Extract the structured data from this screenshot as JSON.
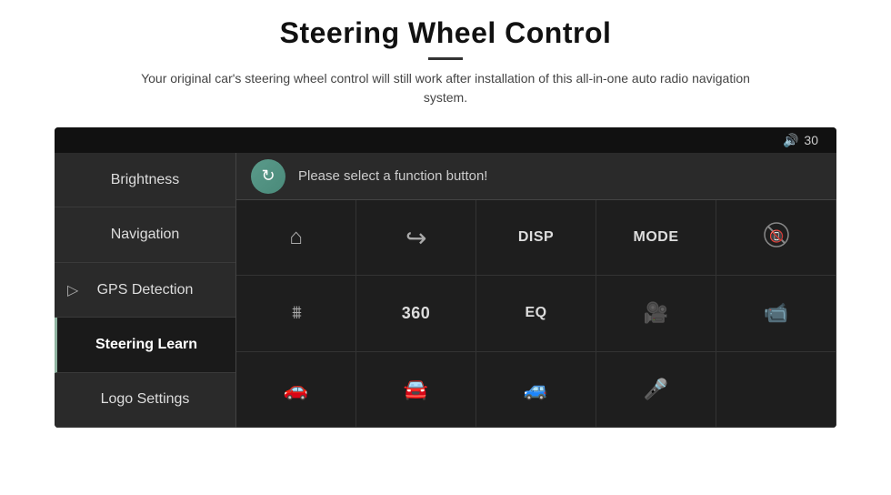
{
  "header": {
    "title": "Steering Wheel Control",
    "divider": true,
    "subtitle": "Your original car's steering wheel control will still work after installation of this all-in-one auto radio navigation system."
  },
  "status_bar": {
    "volume_icon": "🔊",
    "volume_value": "30"
  },
  "sidebar": {
    "items": [
      {
        "id": "brightness",
        "label": "Brightness",
        "active": false
      },
      {
        "id": "navigation",
        "label": "Navigation",
        "active": false
      },
      {
        "id": "gps-detection",
        "label": "GPS Detection",
        "active": false
      },
      {
        "id": "steering-learn",
        "label": "Steering Learn",
        "active": true
      },
      {
        "id": "logo-settings",
        "label": "Logo Settings",
        "active": false
      }
    ]
  },
  "prompt": {
    "text": "Please select a function button!"
  },
  "grid": {
    "rows": [
      [
        {
          "id": "home",
          "icon": "⌂",
          "type": "icon"
        },
        {
          "id": "back",
          "icon": "↺",
          "type": "icon"
        },
        {
          "id": "disp",
          "label": "DISP",
          "type": "text"
        },
        {
          "id": "mode",
          "label": "MODE",
          "type": "text"
        },
        {
          "id": "phone-off",
          "icon": "⊘",
          "type": "icon"
        }
      ],
      [
        {
          "id": "tuner",
          "icon": "♯",
          "type": "icon"
        },
        {
          "id": "360",
          "label": "360",
          "type": "text"
        },
        {
          "id": "eq",
          "label": "EQ",
          "type": "text"
        },
        {
          "id": "camera1",
          "icon": "📷",
          "type": "icon"
        },
        {
          "id": "camera2",
          "icon": "🎥",
          "type": "icon"
        }
      ],
      [
        {
          "id": "car1",
          "icon": "🚗",
          "type": "icon"
        },
        {
          "id": "car2",
          "icon": "🚘",
          "type": "icon"
        },
        {
          "id": "car3",
          "icon": "🚙",
          "type": "icon"
        },
        {
          "id": "mic",
          "icon": "🎤",
          "type": "icon"
        },
        {
          "id": "empty",
          "icon": "",
          "type": "icon"
        }
      ]
    ]
  }
}
